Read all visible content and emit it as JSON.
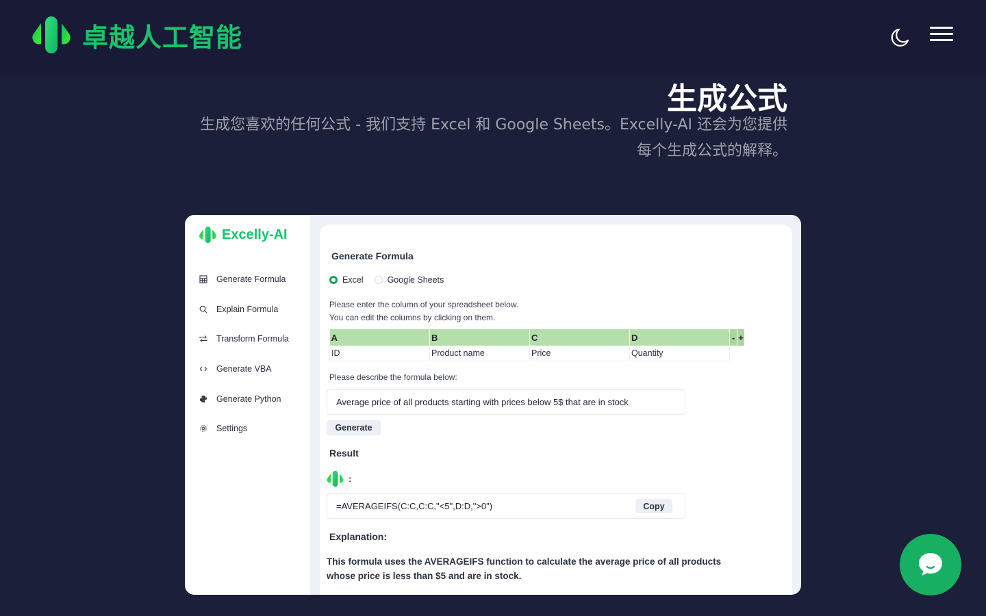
{
  "header": {
    "brand_name": "卓越人工智能",
    "theme_toggle_icon": "moon-icon",
    "menu_icon": "hamburger-menu-icon"
  },
  "hero": {
    "title": "生成公式",
    "subtitle": "生成您喜欢的任何公式 - 我们支持 Excel 和 Google Sheets。Excelly-AI 还会为您提供每个生成公式的解释。"
  },
  "app": {
    "brand_name": "Excelly-AI",
    "sidebar": {
      "items": [
        {
          "label": "Generate Formula",
          "icon": "table-icon"
        },
        {
          "label": "Explain Formula",
          "icon": "search-icon"
        },
        {
          "label": "Transform Formula",
          "icon": "repeat-arrows-icon"
        },
        {
          "label": "Generate VBA",
          "icon": "code-brackets-icon"
        },
        {
          "label": "Generate Python",
          "icon": "python-icon"
        },
        {
          "label": "Settings",
          "icon": "gear-icon"
        }
      ]
    },
    "main": {
      "title": "Generate Formula",
      "platform_options": [
        {
          "label": "Excel",
          "selected": true
        },
        {
          "label": "Google Sheets",
          "selected": false
        }
      ],
      "instructions_line1": "Please enter the column of your spreadsheet below.",
      "instructions_line2": "You can edit the columns by clicking on them.",
      "columns": {
        "headers": [
          "A",
          "B",
          "C",
          "D"
        ],
        "values": [
          "ID",
          "Product name",
          "Price",
          "Quantity"
        ],
        "remove_label": "-",
        "add_label": "+"
      },
      "describe_label": "Please describe the formula below:",
      "description_value": "Average price of all products starting with prices below 5$ that are in stock",
      "generate_label": "Generate",
      "result_label": "Result",
      "result_colon": ":",
      "formula": "=AVERAGEIFS(C:C,C:C,\"<5\",D:D,\">0\")",
      "copy_label": "Copy",
      "explanation_label": "Explanation:",
      "explanation_text": "This formula uses the AVERAGEIFS function to calculate the average price of all products whose price is less than $5 and are in stock."
    }
  },
  "chat_widget": {
    "icon": "chat-bubble-icon",
    "color": "#17b062"
  },
  "colors": {
    "background": "#1c1f3a",
    "brand_green": "#18c46a",
    "header_cell_green": "#b5dfaa"
  }
}
